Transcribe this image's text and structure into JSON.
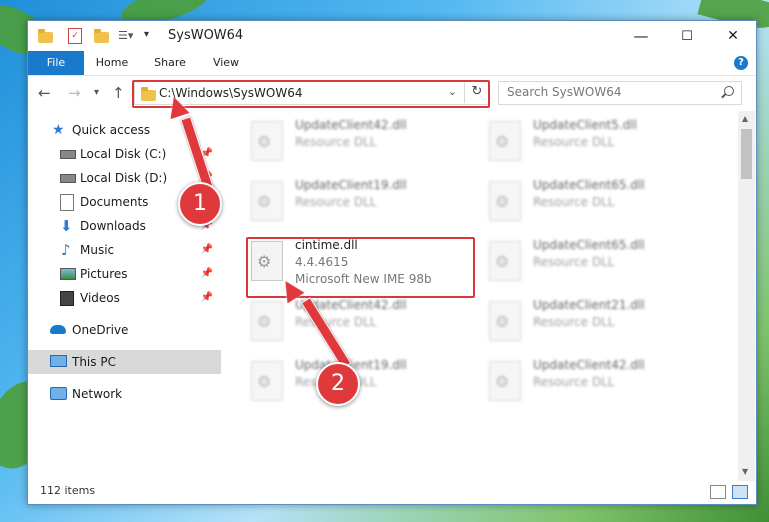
{
  "window": {
    "title": "SysWOW64",
    "controls": {
      "minimize": "—",
      "maximize": "☐",
      "close": "✕"
    }
  },
  "ribbon": {
    "tabs": [
      "File",
      "Home",
      "Share",
      "View"
    ],
    "help": "?"
  },
  "address": {
    "path": "C:\\Windows\\SysWOW64"
  },
  "search": {
    "placeholder": "Search SysWOW64"
  },
  "sidebar": {
    "items": [
      {
        "label": "Quick access",
        "icon": "star-icon",
        "pinned": false
      },
      {
        "label": "Local Disk (C:)",
        "icon": "drive-icon",
        "pinned": true
      },
      {
        "label": "Local Disk (D:)",
        "icon": "drive-icon",
        "pinned": true
      },
      {
        "label": "Documents",
        "icon": "documents-icon",
        "pinned": true
      },
      {
        "label": "Downloads",
        "icon": "download-icon",
        "pinned": true
      },
      {
        "label": "Music",
        "icon": "music-icon",
        "pinned": true
      },
      {
        "label": "Pictures",
        "icon": "pictures-icon",
        "pinned": true
      },
      {
        "label": "Videos",
        "icon": "videos-icon",
        "pinned": true
      },
      {
        "label": "OneDrive",
        "icon": "cloud-icon",
        "pinned": false
      },
      {
        "label": "This PC",
        "icon": "pc-icon",
        "pinned": false,
        "selected": true
      },
      {
        "label": "Network",
        "icon": "network-icon",
        "pinned": false
      }
    ],
    "pin_glyph": "📌"
  },
  "files": {
    "left": [
      {
        "name": "UpdateClient42.dll",
        "line2": "Resource DLL",
        "line3": ""
      },
      {
        "name": "UpdateClient19.dll",
        "line2": "Resource DLL",
        "line3": ""
      },
      {
        "name": "cintime.dll",
        "line2": "4.4.4615",
        "line3": "Microsoft New IME 98b",
        "highlighted": true
      },
      {
        "name": "UpdateClient42.dll",
        "line2": "Resource DLL",
        "line3": ""
      },
      {
        "name": "UpdateClient19.dll",
        "line2": "Resource DLL",
        "line3": ""
      }
    ],
    "right": [
      {
        "name": "UpdateClient5.dll",
        "line2": "Resource DLL"
      },
      {
        "name": "UpdateClient65.dll",
        "line2": "Resource DLL"
      },
      {
        "name": "UpdateClient65.dll",
        "line2": "Resource DLL"
      },
      {
        "name": "UpdateClient21.dll",
        "line2": "Resource DLL"
      },
      {
        "name": "UpdateClient42.dll",
        "line2": "Resource DLL"
      }
    ]
  },
  "status": {
    "item_count": "112 items"
  },
  "annotations": {
    "step1": "1",
    "step2": "2",
    "color": "#e0393c"
  }
}
